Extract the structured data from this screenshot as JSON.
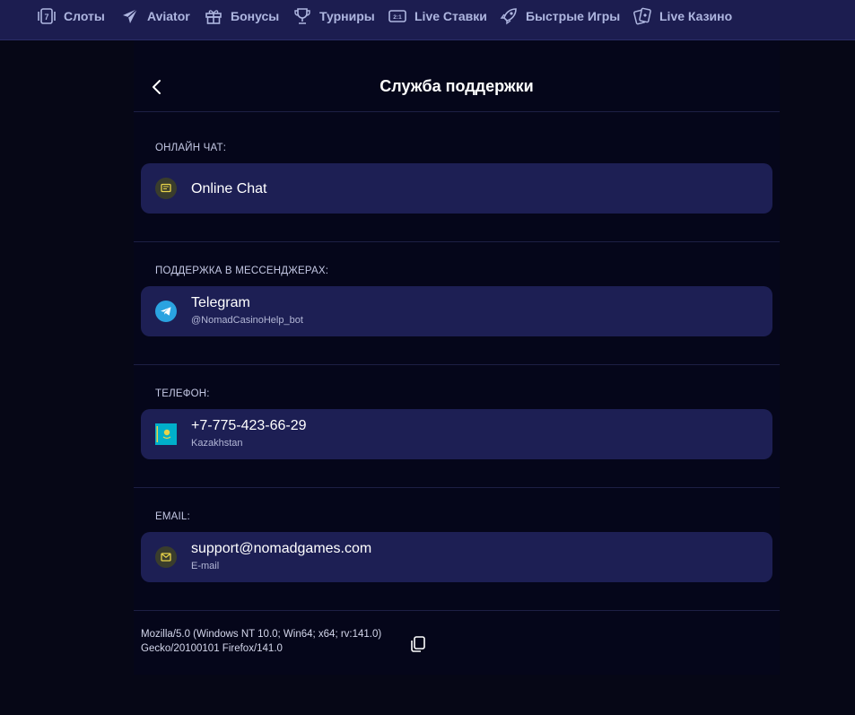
{
  "nav": {
    "items": [
      {
        "label": "Слоты",
        "icon": "slots-icon"
      },
      {
        "label": "Aviator",
        "icon": "plane-icon"
      },
      {
        "label": "Бонусы",
        "icon": "gift-icon"
      },
      {
        "label": "Турниры",
        "icon": "trophy-icon"
      },
      {
        "label": "Live Ставки",
        "icon": "scoreboard-icon"
      },
      {
        "label": "Быстрые Игры",
        "icon": "rocket-icon"
      },
      {
        "label": "Live Казино",
        "icon": "cards-icon"
      }
    ]
  },
  "page": {
    "title": "Служба поддержки"
  },
  "sections": {
    "chat": {
      "label": "ОНЛАЙН ЧАТ:",
      "name": "Online Chat"
    },
    "messengers": {
      "label": "ПОДДЕРЖКА В МЕССЕНДЖЕРАХ:",
      "name": "Telegram",
      "sub": "@NomadCasinoHelp_bot"
    },
    "phone": {
      "label": "ТЕЛЕФОН:",
      "name": "+7-775-423-66-29",
      "sub": "Kazakhstan"
    },
    "email": {
      "label": "EMAIL:",
      "name": "support@nomadgames.com",
      "sub": "E-mail"
    }
  },
  "user_agent": {
    "line1": "Mozilla/5.0 (Windows NT 10.0; Win64; x64; rv:141.0)",
    "line2": "Gecko/20100101 Firefox/141.0"
  },
  "colors": {
    "nav_bg": "#1c1d50",
    "page_bg": "#060716",
    "card_bg": "#1d1f54",
    "accent_yellow": "#e8d44a",
    "telegram_blue": "#2aa3e0",
    "kz_flag": "#00afca"
  }
}
